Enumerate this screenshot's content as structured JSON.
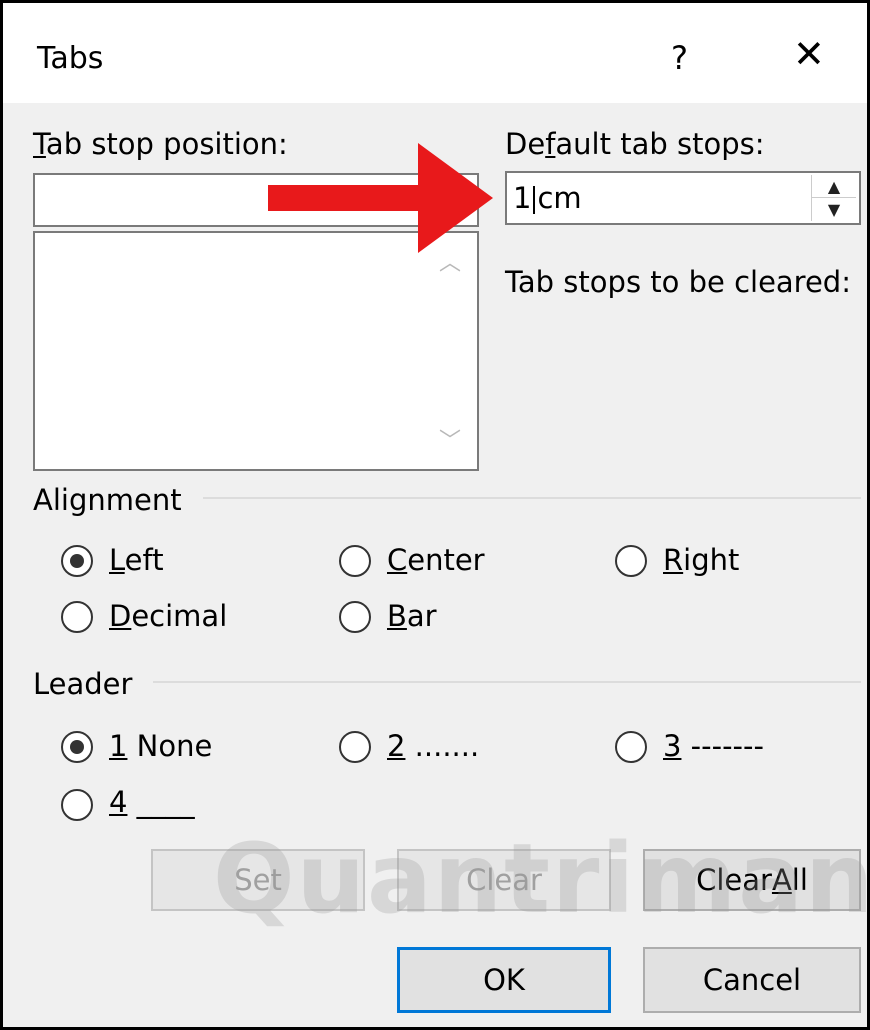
{
  "window": {
    "title": "Tabs",
    "help": "?",
    "close": "✕"
  },
  "tab_stop": {
    "label_u": "T",
    "label_rest": "ab stop position:",
    "value": ""
  },
  "default_tab": {
    "label_a": "De",
    "label_u": "f",
    "label_b": "ault tab stops:",
    "value_before": "1",
    "value_after": "cm"
  },
  "cleared_label": "Tab stops to be cleared:",
  "alignment": {
    "heading": "Alignment",
    "options": [
      {
        "key": "L",
        "rest": "eft",
        "selected": true
      },
      {
        "key": "C",
        "rest": "enter",
        "selected": false
      },
      {
        "key": "R",
        "rest": "ight",
        "selected": false
      },
      {
        "key": "D",
        "rest": "ecimal",
        "selected": false
      },
      {
        "key": "B",
        "rest": "ar",
        "selected": false
      }
    ]
  },
  "leader": {
    "heading": "Leader",
    "options": [
      {
        "key": "1",
        "rest": " None",
        "selected": true
      },
      {
        "key": "2",
        "rest": " .......",
        "selected": false
      },
      {
        "key": "3",
        "rest": " -------",
        "selected": false
      },
      {
        "key": "4",
        "rest": " ____",
        "selected": false
      }
    ]
  },
  "buttons": {
    "set": "Set",
    "clear": "Clear",
    "clear_all_a": "Clear ",
    "clear_all_u": "A",
    "clear_all_b": "ll",
    "ok": "OK",
    "cancel": "Cancel"
  },
  "watermark": "Quantrimang",
  "arrow_color": "#e8191b"
}
